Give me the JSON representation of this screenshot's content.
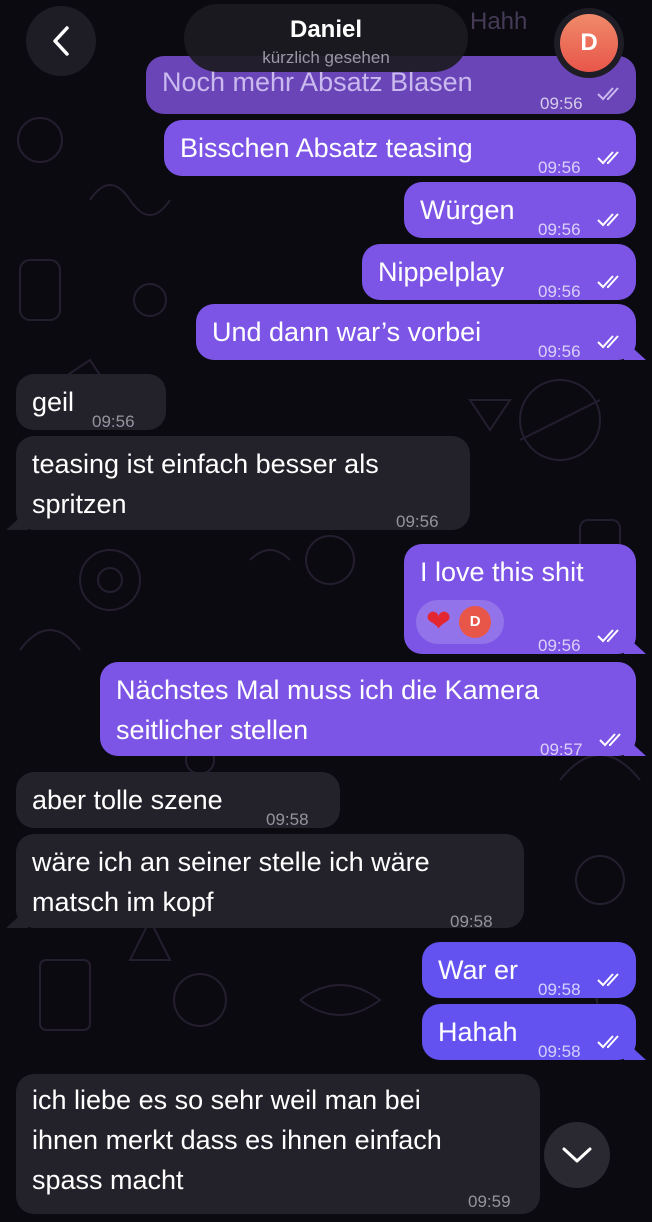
{
  "header": {
    "back_icon": "chevron-left-icon",
    "contact_name": "Daniel",
    "status": "kürzlich gesehen",
    "avatar_letter": "D",
    "ghost_text": "Hahh"
  },
  "messages": [
    {
      "dir": "out",
      "text": "Noch mehr Absatz Blasen",
      "time": "09:56",
      "read": true
    },
    {
      "dir": "out",
      "text": "Bisschen Absatz teasing",
      "time": "09:56",
      "read": true
    },
    {
      "dir": "out",
      "text": "Würgen",
      "time": "09:56",
      "read": true
    },
    {
      "dir": "out",
      "text": "Nippelplay",
      "time": "09:56",
      "read": true
    },
    {
      "dir": "out",
      "text": "Und dann war’s vorbei",
      "time": "09:56",
      "read": true
    },
    {
      "dir": "in",
      "text": "geil",
      "time": "09:56"
    },
    {
      "dir": "in",
      "lines": [
        "teasing ist einfach besser als",
        "spritzen"
      ],
      "time": "09:56"
    },
    {
      "dir": "out",
      "text": "I love this shit",
      "time": "09:56",
      "read": true,
      "reaction": {
        "emoji": "❤",
        "avatar_letter": "D"
      }
    },
    {
      "dir": "out",
      "lines": [
        "Nächstes Mal muss ich die Kamera",
        "seitlicher stellen"
      ],
      "time": "09:57",
      "read": true
    },
    {
      "dir": "in",
      "text": "aber tolle szene",
      "time": "09:58"
    },
    {
      "dir": "in",
      "lines": [
        "wäre ich an seiner stelle ich wäre",
        "matsch im kopf"
      ],
      "time": "09:58"
    },
    {
      "dir": "out",
      "text": "War er",
      "time": "09:58",
      "read": true
    },
    {
      "dir": "out",
      "text": "Hahah",
      "time": "09:58",
      "read": true
    },
    {
      "dir": "in",
      "lines": [
        "ich liebe es so sehr weil man bei",
        "ihnen merkt dass es ihnen einfach",
        "spass macht"
      ],
      "time": "09:59"
    }
  ],
  "scroll_down_icon": "chevron-down-icon",
  "colors": {
    "outgoing": "#7c55e6",
    "outgoing_blue": "#6452f0",
    "incoming": "#232129",
    "background": "#0b0a10"
  }
}
